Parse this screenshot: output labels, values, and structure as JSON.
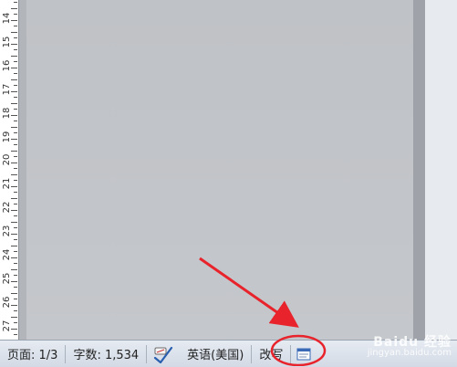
{
  "ruler": {
    "numbers": [
      "14",
      "15",
      "16",
      "17",
      "18",
      "19",
      "20",
      "21",
      "22",
      "23",
      "24",
      "25",
      "26",
      "27"
    ]
  },
  "statusbar": {
    "page_info": "页面: 1/3",
    "word_count": "字数: 1,534",
    "language": "英语(美国)",
    "overtype_mode": "改写"
  },
  "icons": {
    "spell_check": "spell-check-icon",
    "view_layout": "print-layout-view-icon"
  },
  "annotation": {
    "color": "#e8232b"
  },
  "watermark": {
    "brand": "Baidu 经验",
    "url": "jingyan.baidu.com"
  }
}
